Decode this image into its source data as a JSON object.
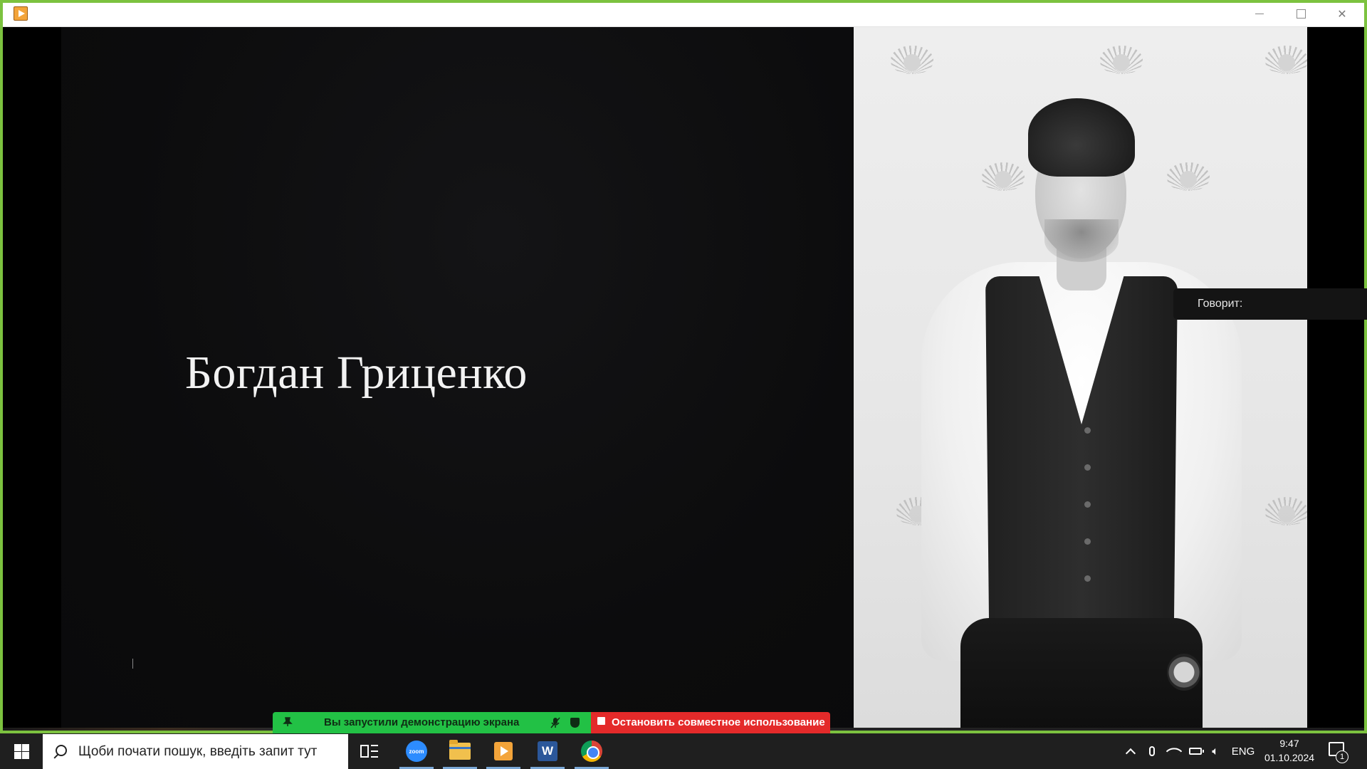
{
  "slide": {
    "presenter_name": "Богдан Гриценко"
  },
  "speaking_indicator": {
    "label": "Говорит:"
  },
  "share_bar": {
    "status_text": "Вы запустили демонстрацию экрана",
    "stop_label": "Остановить совместное использование",
    "status_color": "#22c145",
    "stop_color": "#e42a2a"
  },
  "taskbar": {
    "search_placeholder": "Щоби почати пошук, введіть запит тут",
    "apps": [
      {
        "name": "zoom",
        "icon": "zoom-icon",
        "label": "zoom"
      },
      {
        "name": "file-explorer",
        "icon": "folder-icon"
      },
      {
        "name": "powerpoint-slideshow",
        "icon": "slideshow-icon"
      },
      {
        "name": "word",
        "icon": "word-icon",
        "label": "W"
      },
      {
        "name": "chrome",
        "icon": "chrome-icon"
      }
    ],
    "tray": {
      "language": "ENG",
      "time": "9:47",
      "date": "01.10.2024",
      "notification_count": "1"
    }
  }
}
